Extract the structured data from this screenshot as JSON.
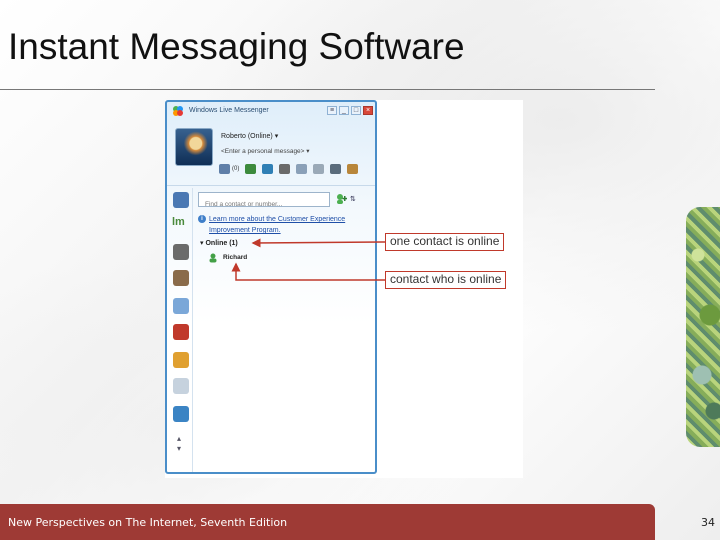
{
  "slide": {
    "title": "Instant Messaging Software",
    "footer": "New Perspectives on The Internet, Seventh Edition",
    "page_number": "34"
  },
  "messenger": {
    "window_title": "Windows Live Messenger",
    "user_name": "Roberto (Online)",
    "personal_message": "<Enter a personal message>",
    "mail_count": "(0)",
    "search_placeholder": "Find a contact or number...",
    "info_link": "Learn more about the Customer Experience Improvement Program.",
    "group_header": "Online (1)",
    "contact_name": "Richard"
  },
  "callouts": {
    "online_count": "one contact is online",
    "online_contact": "contact who is online"
  },
  "colors": {
    "accent": "#9e3a35",
    "callout_border": "#c0392b",
    "window_border": "#4a8ec9",
    "link": "#1f4fa8"
  }
}
